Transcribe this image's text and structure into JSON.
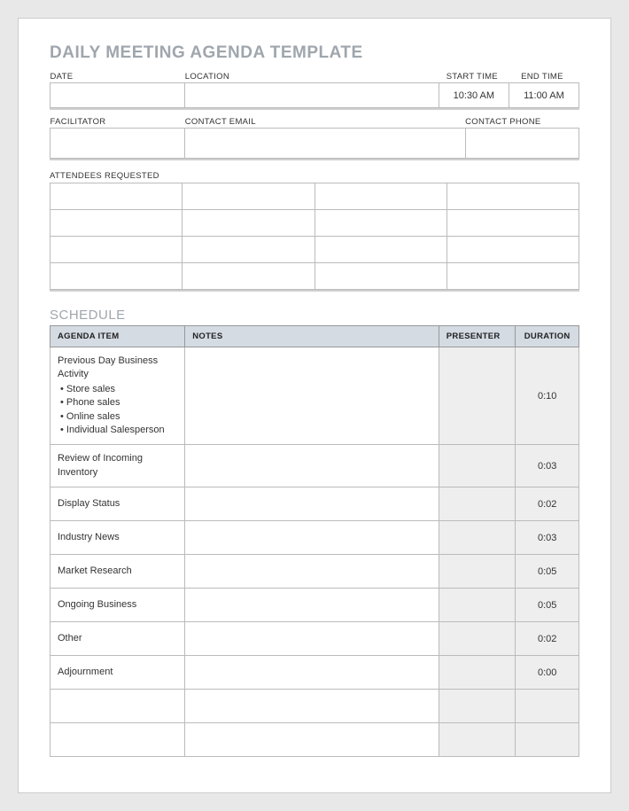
{
  "title": "DAILY MEETING AGENDA TEMPLATE",
  "labels": {
    "date": "DATE",
    "location": "LOCATION",
    "start_time": "START TIME",
    "end_time": "END TIME",
    "facilitator": "FACILITATOR",
    "contact_email": "CONTACT EMAIL",
    "contact_phone": "CONTACT PHONE",
    "attendees": "ATTENDEES REQUESTED",
    "schedule": "SCHEDULE"
  },
  "info": {
    "date": "",
    "location": "",
    "start_time": "10:30 AM",
    "end_time": "11:00 AM",
    "facilitator": "",
    "contact_email": "",
    "contact_phone": ""
  },
  "attendees_rows": 4,
  "attendees_cols": 4,
  "schedule": {
    "headers": {
      "item": "AGENDA ITEM",
      "notes": "NOTES",
      "presenter": "PRESENTER",
      "duration": "DURATION"
    },
    "rows": [
      {
        "item": "Previous Day Business Activity",
        "bullets": [
          "Store sales",
          "Phone sales",
          "Online sales",
          "Individual Salesperson"
        ],
        "notes": "",
        "presenter": "",
        "duration": "0:10"
      },
      {
        "item": "Review of Incoming Inventory",
        "bullets": [],
        "notes": "",
        "presenter": "",
        "duration": "0:03"
      },
      {
        "item": "Display Status",
        "bullets": [],
        "notes": "",
        "presenter": "",
        "duration": "0:02"
      },
      {
        "item": "Industry News",
        "bullets": [],
        "notes": "",
        "presenter": "",
        "duration": "0:03"
      },
      {
        "item": "Market Research",
        "bullets": [],
        "notes": "",
        "presenter": "",
        "duration": "0:05"
      },
      {
        "item": "Ongoing Business",
        "bullets": [],
        "notes": "",
        "presenter": "",
        "duration": "0:05"
      },
      {
        "item": "Other",
        "bullets": [],
        "notes": "",
        "presenter": "",
        "duration": "0:02"
      },
      {
        "item": "Adjournment",
        "bullets": [],
        "notes": "",
        "presenter": "",
        "duration": "0:00"
      },
      {
        "item": "",
        "bullets": [],
        "notes": "",
        "presenter": "",
        "duration": ""
      },
      {
        "item": "",
        "bullets": [],
        "notes": "",
        "presenter": "",
        "duration": ""
      }
    ]
  }
}
